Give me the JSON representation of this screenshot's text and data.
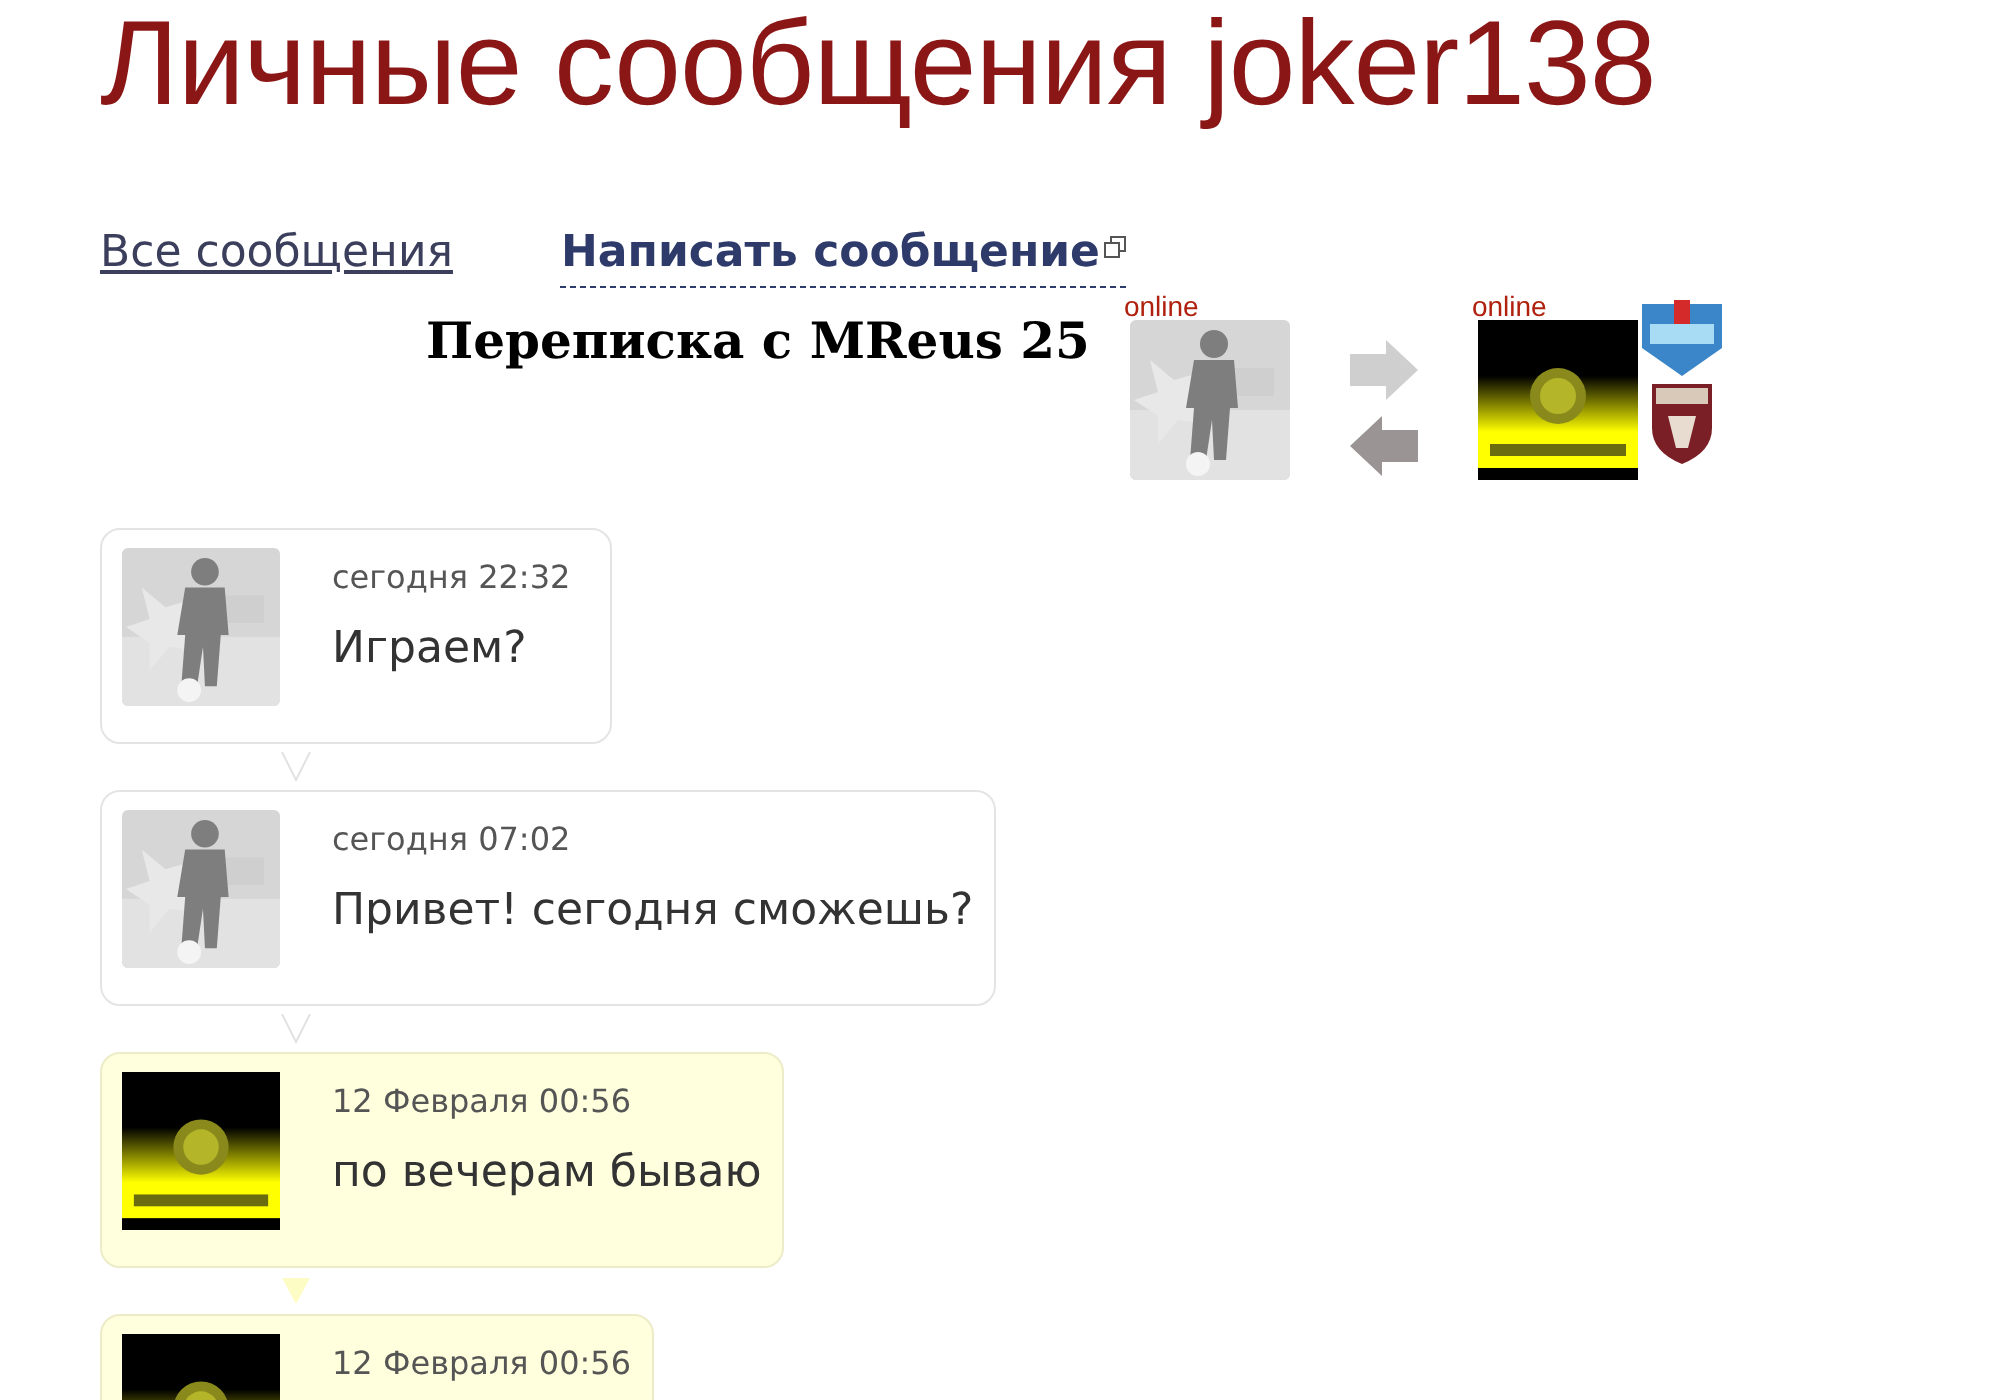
{
  "title": "Личные сообщения joker138",
  "links": [
    {
      "label": "Все сообщения",
      "kind": "plain"
    },
    {
      "label": "Написать сообщение",
      "kind": "popup"
    }
  ],
  "conversation": {
    "heading": "Переписка с MReus 25",
    "participants": [
      {
        "status": "online",
        "kind": "gray"
      },
      {
        "status": "online",
        "kind": "yellow"
      }
    ]
  },
  "messages": [
    {
      "kind": "incoming",
      "time": "сегодня 22:32",
      "text": "Играем?"
    },
    {
      "kind": "incoming",
      "time": "сегодня 07:02",
      "text": "Привет! сегодня сможешь?"
    },
    {
      "kind": "outgoing",
      "time": "12 Февраля 00:56",
      "text": "по вечерам бываю"
    },
    {
      "kind": "outgoing",
      "time": "12 Февраля 00:56"
    }
  ]
}
